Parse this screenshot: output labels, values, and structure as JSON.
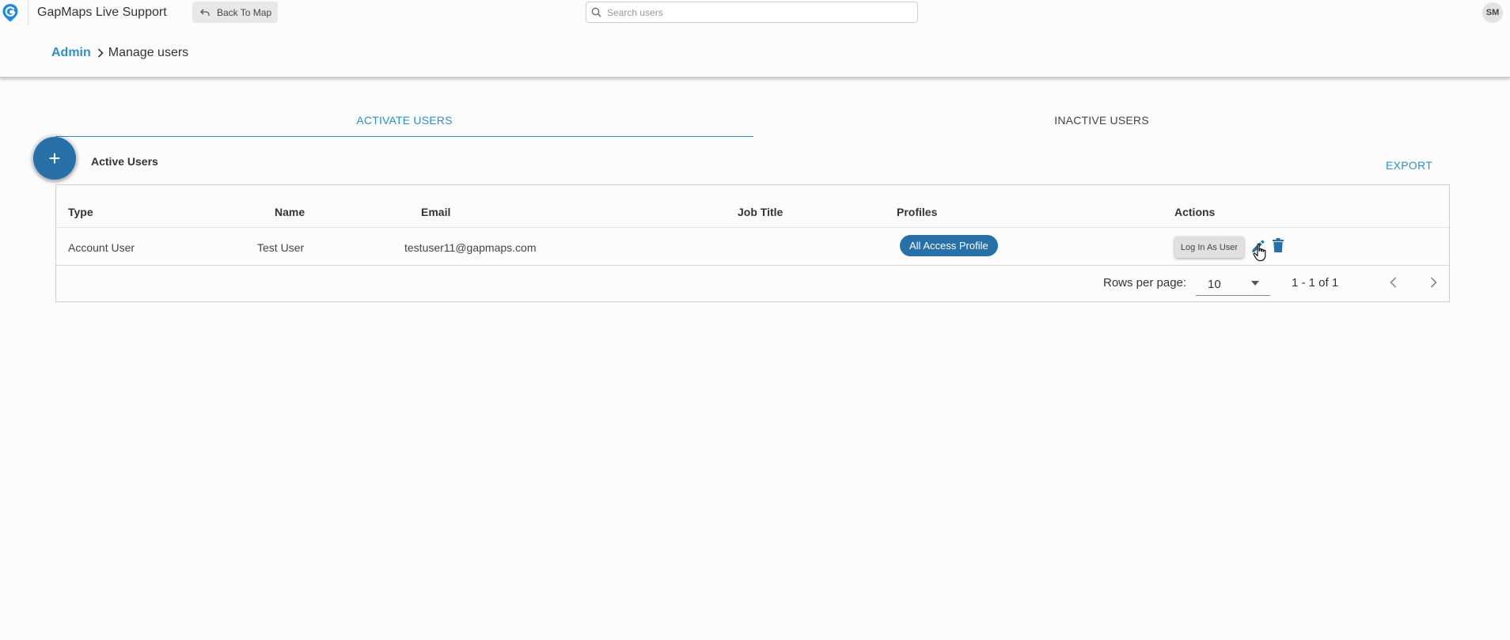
{
  "app": {
    "title": "GapMaps Live Support",
    "logo_icon": "gapmaps-logo-icon",
    "back_button_label": "Back To Map",
    "back_icon": "undo-arrow-icon"
  },
  "search": {
    "placeholder": "Search users",
    "value": "",
    "icon": "search-icon"
  },
  "user_avatar": {
    "initials": "SM"
  },
  "breadcrumb": {
    "parent": "Admin",
    "separator_icon": "chevron-right-icon",
    "current": "Manage users"
  },
  "tabs": [
    {
      "label": "ACTIVATE USERS",
      "active": true
    },
    {
      "label": "INACTIVE USERS",
      "active": false
    }
  ],
  "section": {
    "add_button_glyph": "+",
    "title": "Active Users",
    "export_label": "EXPORT"
  },
  "table": {
    "columns": [
      "Type",
      "Name",
      "Email",
      "Job Title",
      "Profiles",
      "Actions"
    ],
    "rows": [
      {
        "type": "Account User",
        "name": "Test User",
        "email": "testuser11@gapmaps.com",
        "job_title": "",
        "profile": "All Access Profile",
        "login_as_label": "Log In As User",
        "edit_icon": "pencil-icon",
        "delete_icon": "trash-icon"
      }
    ]
  },
  "pagination": {
    "rows_per_page_label": "Rows per page:",
    "rows_per_page_value": "10",
    "range_text": "1 - 1 of 1",
    "prev_icon": "chevron-left-icon",
    "next_icon": "chevron-right-icon"
  },
  "colors": {
    "accent": "#2d8fc9",
    "primary_button": "#2870a8",
    "background": "#fcfcfc"
  }
}
